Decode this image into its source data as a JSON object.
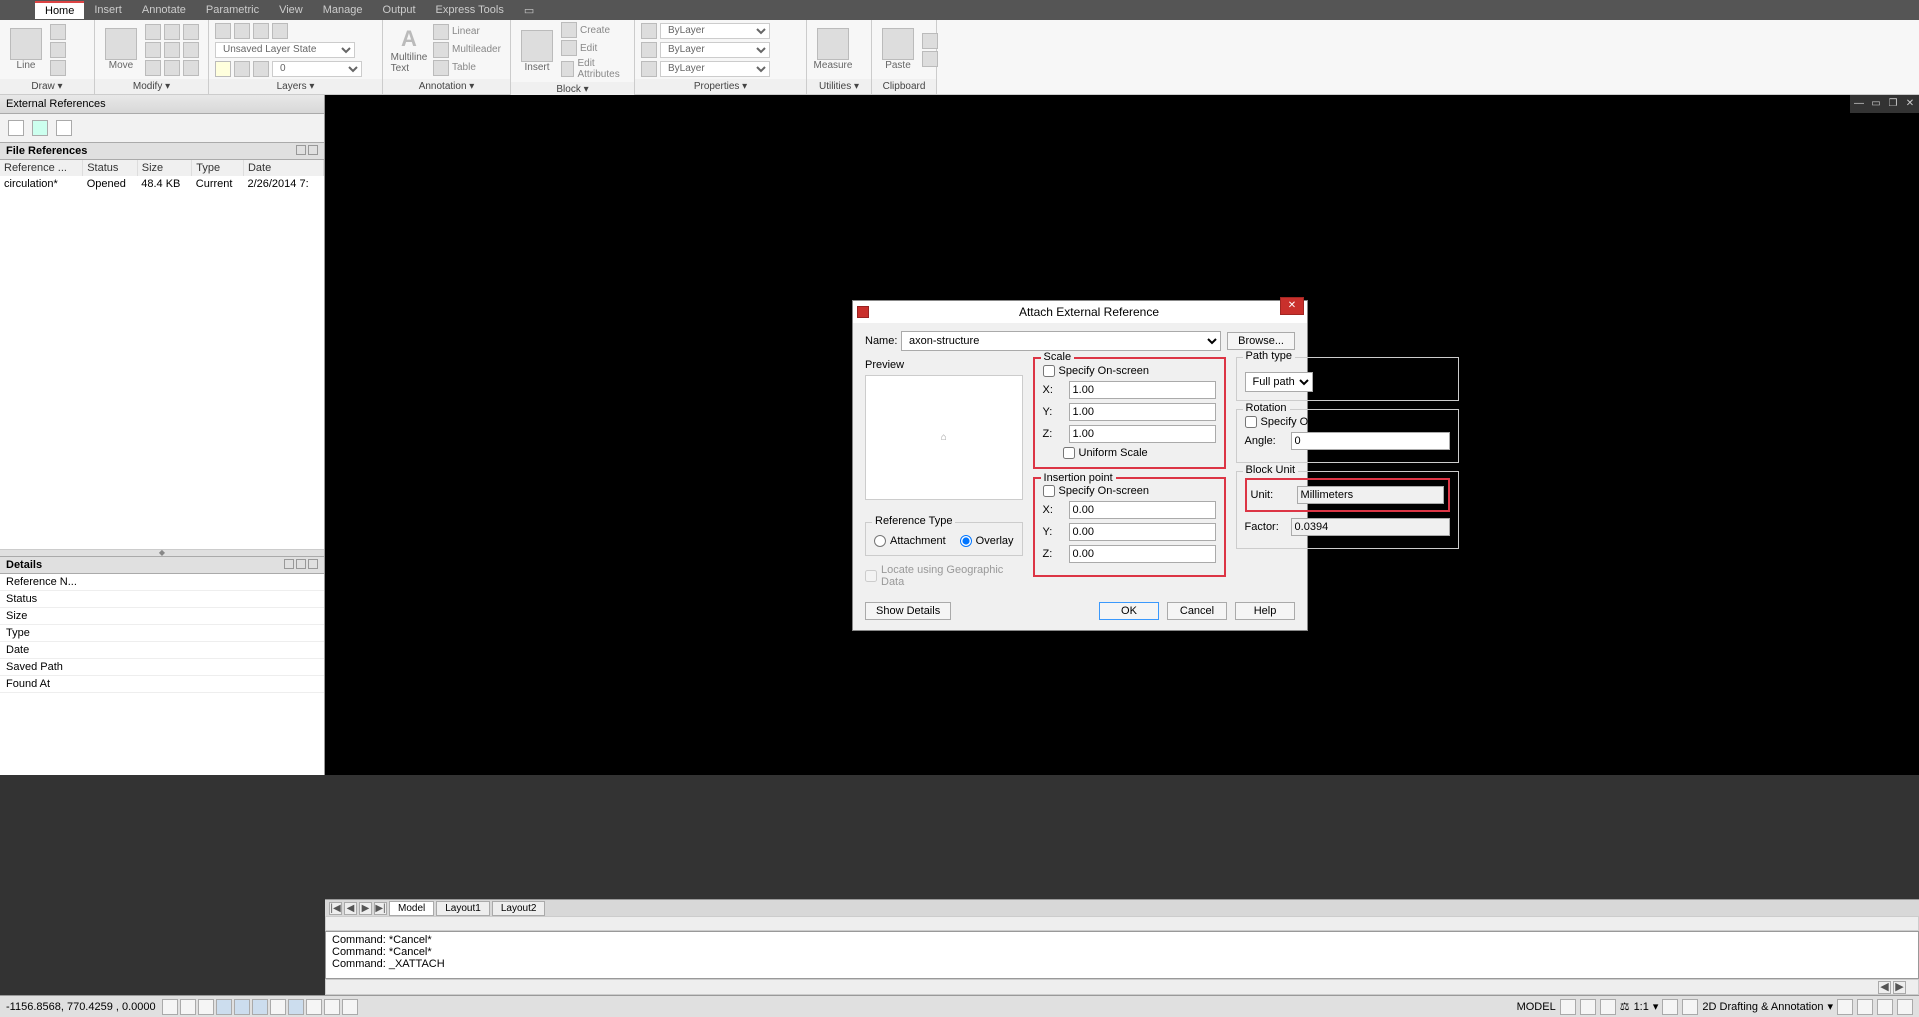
{
  "menubar": {
    "items": [
      "Home",
      "Insert",
      "Annotate",
      "Parametric",
      "View",
      "Manage",
      "Output",
      "Express Tools"
    ],
    "active": 0
  },
  "ribbon": {
    "panels": [
      {
        "label": "Draw ▾",
        "btn": "Line"
      },
      {
        "label": "Modify ▾",
        "btn": "Move"
      },
      {
        "label": "Layers ▾",
        "state": "Unsaved Layer State",
        "layer": "0"
      },
      {
        "label": "Annotation ▾",
        "btn": "Multiline Text",
        "items": [
          "Linear",
          "Multileader",
          "Table"
        ]
      },
      {
        "label": "Block ▾",
        "btn": "Insert",
        "items": [
          "Create",
          "Edit",
          "Edit Attributes"
        ]
      },
      {
        "label": "Properties ▾",
        "bylayer": "ByLayer"
      },
      {
        "label": "Utilities ▾",
        "btn": "Measure"
      },
      {
        "label": "Clipboard",
        "btn": "Paste"
      }
    ]
  },
  "leftPanel": {
    "title": "External References",
    "fileRef": {
      "title": "File References",
      "headers": [
        "Reference ...",
        "Status",
        "Size",
        "Type",
        "Date"
      ],
      "rows": [
        [
          "circulation*",
          "Opened",
          "48.4 KB",
          "Current",
          "2/26/2014 7:"
        ]
      ]
    },
    "details": {
      "title": "Details",
      "rows": [
        "Reference N...",
        "Status",
        "Size",
        "Type",
        "Date",
        "Saved Path",
        "Found At"
      ]
    }
  },
  "dialog": {
    "title": "Attach External Reference",
    "nameLabel": "Name:",
    "nameValue": "axon-structure",
    "browse": "Browse...",
    "previewLabel": "Preview",
    "refType": {
      "label": "Reference Type",
      "attachment": "Attachment",
      "overlay": "Overlay",
      "selected": "overlay"
    },
    "locateGeo": "Locate using Geographic Data",
    "scale": {
      "label": "Scale",
      "specify": "Specify On-screen",
      "x": "1.00",
      "y": "1.00",
      "z": "1.00",
      "uniform": "Uniform Scale"
    },
    "insertion": {
      "label": "Insertion point",
      "specify": "Specify On-screen",
      "x": "0.00",
      "y": "0.00",
      "z": "0.00"
    },
    "pathType": {
      "label": "Path type",
      "value": "Full path"
    },
    "rotation": {
      "label": "Rotation",
      "specify": "Specify On-screen",
      "angleLabel": "Angle:",
      "angle": "0"
    },
    "blockUnit": {
      "label": "Block Unit",
      "unitLabel": "Unit:",
      "unit": "Millimeters",
      "factorLabel": "Factor:",
      "factor": "0.0394"
    },
    "showDetails": "Show Details",
    "ok": "OK",
    "cancel": "Cancel",
    "help": "Help"
  },
  "tabs": {
    "items": [
      "Model",
      "Layout1",
      "Layout2"
    ],
    "active": 0
  },
  "command": {
    "lines": [
      "Command: *Cancel*",
      "Command: *Cancel*",
      "Command: _XATTACH"
    ]
  },
  "status": {
    "coords": "-1156.8568, 770.4259 , 0.0000",
    "model": "MODEL",
    "scale": "1:1",
    "workspace": "2D Drafting & Annotation"
  }
}
